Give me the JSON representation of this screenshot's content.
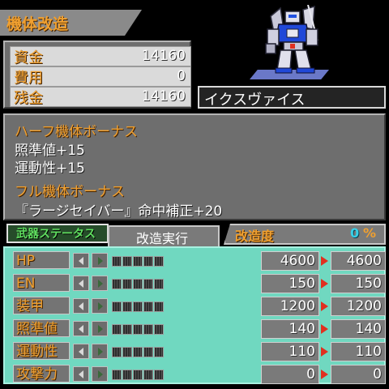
{
  "screen_title": "機体改造",
  "funds": {
    "rows": [
      {
        "label": "資金",
        "value": "14160"
      },
      {
        "label": "費用",
        "value": "0"
      },
      {
        "label": "残金",
        "value": "14160"
      }
    ]
  },
  "unit_name": "イクスヴァイス",
  "bonus": {
    "half_title": "ハーフ機体ボーナス",
    "half_lines": [
      "照準値+15",
      "運動性+15"
    ],
    "full_title": "フル機体ボーナス",
    "full_line": "『ラージセイバー』命中補正+20"
  },
  "tabs": {
    "weapons": "武器ステータス",
    "execute": "改造実行"
  },
  "upgrade_rate": {
    "label": "改造度",
    "value": "0",
    "unit": "%"
  },
  "stats": [
    {
      "label": "HP",
      "current": "4600",
      "after": "4600",
      "level": 0,
      "max_level": 5
    },
    {
      "label": "EN",
      "current": "150",
      "after": "150",
      "level": 0,
      "max_level": 5
    },
    {
      "label": "装甲",
      "current": "1200",
      "after": "1200",
      "level": 0,
      "max_level": 5
    },
    {
      "label": "照準値",
      "current": "140",
      "after": "140",
      "level": 0,
      "max_level": 5
    },
    {
      "label": "運動性",
      "current": "110",
      "after": "110",
      "level": 0,
      "max_level": 5
    },
    {
      "label": "攻撃力",
      "current": "0",
      "after": "0",
      "level": 0,
      "max_level": 5
    }
  ],
  "colors": {
    "accent_orange": "#f0a030",
    "stats_panel": "#70d8c0",
    "rate_value": "#38d0e8",
    "increase_arrow": "#e03020"
  }
}
